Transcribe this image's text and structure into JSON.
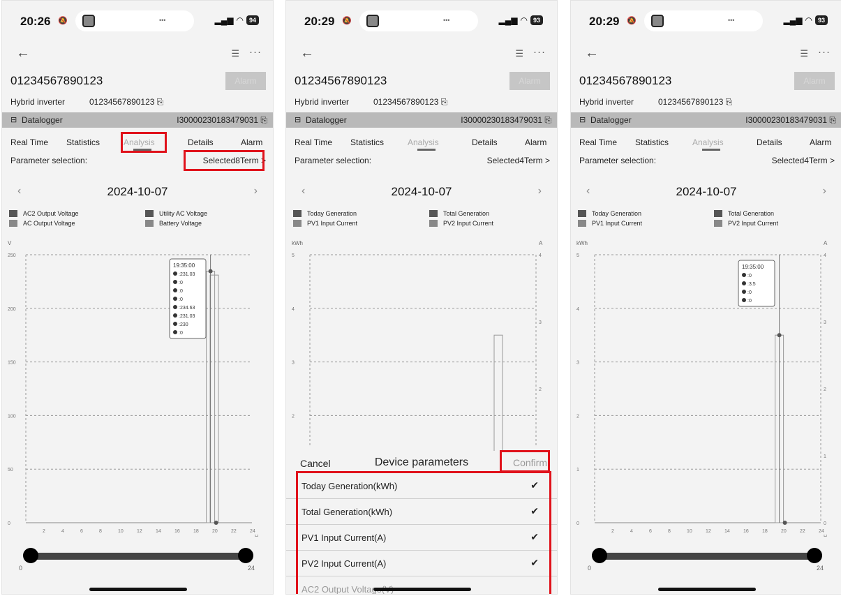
{
  "panels": [
    {
      "status_time": "20:26",
      "battery": "94",
      "serial": "01234567890123",
      "alarm_button": "Alarm",
      "hybrid_label": "Hybrid inverter",
      "hybrid_serial": "01234567890123",
      "datalogger_label": "Datalogger",
      "datalogger_serial": "I30000230183479031",
      "tabs": [
        "Real Time",
        "Statistics",
        "Analysis",
        "Details",
        "Alarm"
      ],
      "active_tab": "Analysis",
      "param_label": "Parameter selection:",
      "param_value": "Selected8Term >",
      "date": "2024-10-07",
      "legend": [
        "AC2 Output Voltage",
        "Utility AC Voltage",
        "AC Output Voltage",
        "Battery Voltage"
      ],
      "slider_min": "0",
      "slider_max": "24"
    },
    {
      "status_time": "20:29",
      "battery": "93",
      "serial": "01234567890123",
      "alarm_button": "Alarm",
      "hybrid_label": "Hybrid inverter",
      "hybrid_serial": "01234567890123",
      "datalogger_label": "Datalogger",
      "datalogger_serial": "I30000230183479031",
      "tabs": [
        "Real Time",
        "Statistics",
        "Analysis",
        "Details",
        "Alarm"
      ],
      "active_tab": "Analysis",
      "param_label": "Parameter selection:",
      "param_value": "Selected4Term >",
      "date": "2024-10-07",
      "legend": [
        "Today Generation",
        "Total Generation",
        "PV1 Input Current",
        "PV2 Input Current"
      ],
      "sheet": {
        "cancel": "Cancel",
        "title": "Device parameters",
        "confirm": "Confirm",
        "items": [
          {
            "label": "Today Generation(kWh)",
            "checked": "✔"
          },
          {
            "label": "Total Generation(kWh)",
            "checked": "✔"
          },
          {
            "label": "PV1 Input Current(A)",
            "checked": "✔"
          },
          {
            "label": "PV2 Input Current(A)",
            "checked": "✔"
          },
          {
            "label": "AC2 Output Voltage(V)",
            "checked": ""
          }
        ]
      }
    },
    {
      "status_time": "20:29",
      "battery": "93",
      "serial": "01234567890123",
      "alarm_button": "Alarm",
      "hybrid_label": "Hybrid inverter",
      "hybrid_serial": "01234567890123",
      "datalogger_label": "Datalogger",
      "datalogger_serial": "I30000230183479031",
      "tabs": [
        "Real Time",
        "Statistics",
        "Analysis",
        "Details",
        "Alarm"
      ],
      "active_tab": "Analysis",
      "param_label": "Parameter selection:",
      "param_value": "Selected4Term >",
      "date": "2024-10-07",
      "legend": [
        "Today Generation",
        "Total Generation",
        "PV1 Input Current",
        "PV2 Input Current"
      ],
      "slider_min": "0",
      "slider_max": "24"
    }
  ],
  "chart_data": [
    {
      "type": "bar",
      "ylabel": "V",
      "xlabel": "H",
      "ylim": [
        0,
        250
      ],
      "yticks": [
        0,
        50,
        100,
        150,
        200,
        250
      ],
      "xticks": [
        2,
        4,
        6,
        8,
        10,
        12,
        14,
        16,
        18,
        20,
        22,
        24
      ],
      "x": [
        19.6,
        20.0
      ],
      "values": [
        234.63,
        231.03
      ],
      "tooltip": {
        "time": "19:35:00",
        "values": [
          ":231.03",
          ":0",
          ":0",
          ":0",
          ":234.63",
          ":231.03",
          ":230",
          ":0"
        ]
      }
    },
    {
      "type": "bar",
      "ylabel": "kWh",
      "y2label": "A",
      "ylim": [
        0,
        5
      ],
      "y2lim": [
        0,
        4
      ],
      "yticks": [
        2,
        3,
        4,
        5
      ],
      "y2ticks": [
        2,
        3,
        4
      ],
      "x": [
        20.0
      ],
      "values": [
        3.5
      ]
    },
    {
      "type": "bar",
      "ylabel": "kWh",
      "y2label": "A",
      "xlabel": "H",
      "ylim": [
        0,
        5
      ],
      "y2lim": [
        0,
        4
      ],
      "yticks": [
        0,
        1,
        2,
        3,
        4,
        5
      ],
      "y2ticks": [
        0,
        1,
        2,
        3,
        4
      ],
      "xticks": [
        2,
        4,
        6,
        8,
        10,
        12,
        14,
        16,
        18,
        20,
        22,
        24
      ],
      "x": [
        19.6
      ],
      "values": [
        3.5
      ],
      "tooltip": {
        "time": "19:35:00",
        "values": [
          ":0",
          ":3.5",
          ":0",
          ":0"
        ]
      }
    }
  ]
}
